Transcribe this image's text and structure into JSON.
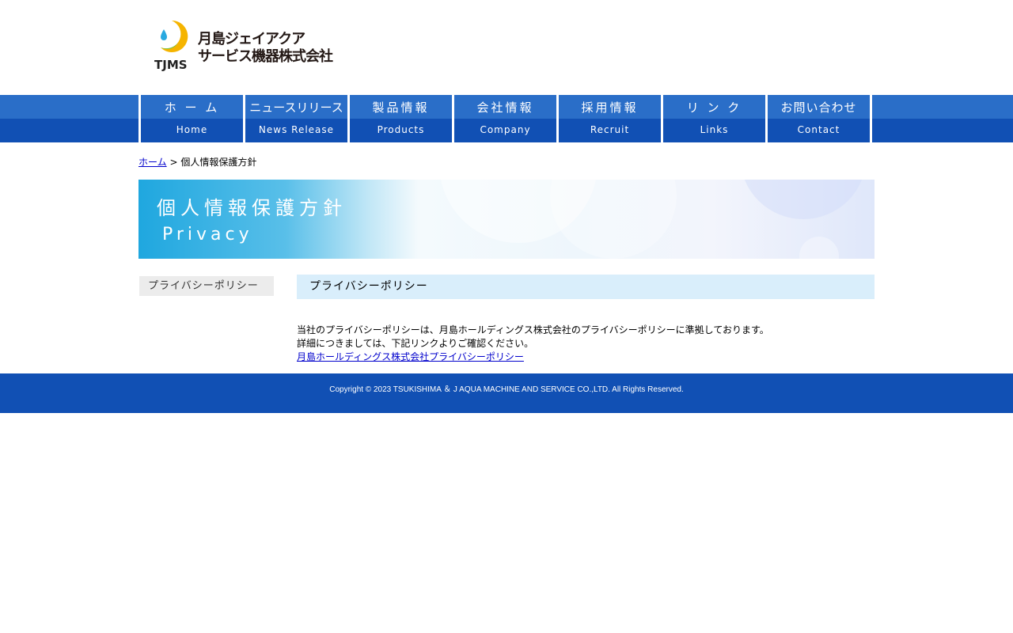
{
  "header": {
    "logo_abbr": "TJMS",
    "logo_line1": "月島ジェイアクア",
    "logo_line2": "サービス機器株式会社"
  },
  "nav": {
    "items": [
      {
        "jp": "ホ ー ム",
        "en": "Home"
      },
      {
        "jp": "ニュースリリース",
        "en": "News Release"
      },
      {
        "jp": "製品情報",
        "en": "Products"
      },
      {
        "jp": "会社情報",
        "en": "Company"
      },
      {
        "jp": "採用情報",
        "en": "Recruit"
      },
      {
        "jp": "リ ン ク",
        "en": "Links"
      },
      {
        "jp": "お問い合わせ",
        "en": "Contact"
      }
    ]
  },
  "breadcrumb": {
    "home": "ホーム",
    "separator": " > ",
    "current": "個人情報保護方針"
  },
  "hero": {
    "title": "個人情報保護方針",
    "subtitle": "Privacy"
  },
  "sidebar": {
    "items": [
      {
        "label": "プライバシーポリシー"
      }
    ]
  },
  "main": {
    "heading": "プライバシーポリシー",
    "line1": "当社のプライバシーポリシーは、月島ホールディングス株式会社のプライバシーポリシーに準拠しております。",
    "line2": "詳細につきましては、下記リンクよりご確認ください。",
    "link": "月島ホールディングス株式会社プライバシーポリシー"
  },
  "footer": {
    "copyright": "Copyright © 2023 TSUKISHIMA ＆ J AQUA MACHINE AND SERVICE CO.,LTD. All Rights Reserved."
  },
  "colors": {
    "nav_top": "#2a6ec8",
    "nav_bottom": "#1150b4",
    "footer": "#1150b4",
    "heading_bg": "#d9eefb",
    "link": "#0000cc"
  }
}
